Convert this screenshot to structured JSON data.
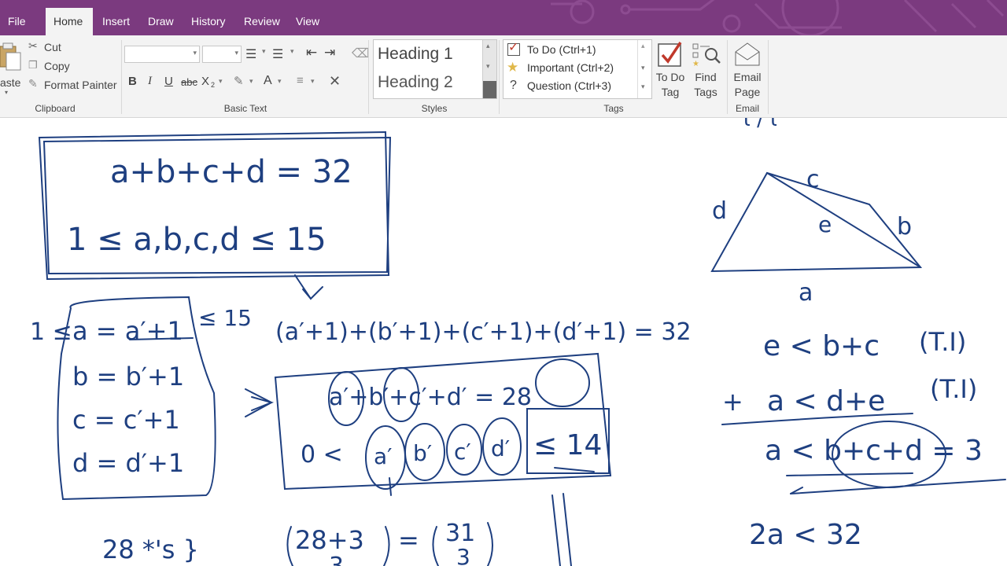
{
  "tabs": [
    "File",
    "Home",
    "Insert",
    "Draw",
    "History",
    "Review",
    "View"
  ],
  "clipboard": {
    "paste_label": "aste",
    "cut": "Cut",
    "copy": "Copy",
    "format_painter": "Format Painter",
    "group_label": "Clipboard"
  },
  "basic_text": {
    "bold": "B",
    "italic": "I",
    "underline": "U",
    "strike": "abc",
    "subscript": "X",
    "font_color": "A",
    "clear": "✕",
    "group_label": "Basic Text"
  },
  "styles": {
    "heading1": "Heading 1",
    "heading2": "Heading 2",
    "group_label": "Styles"
  },
  "tags": {
    "items": [
      "To Do (Ctrl+1)",
      "Important (Ctrl+2)",
      "Question (Ctrl+3)"
    ],
    "todo_tag": [
      "To Do",
      "Tag"
    ],
    "find_tags": [
      "Find",
      "Tags"
    ],
    "group_label": "Tags"
  },
  "email": {
    "label": [
      "Email",
      "Page"
    ],
    "group_label": "Email"
  },
  "ink": {
    "box_eq1": "a+b+c+d = 32",
    "box_eq2": "1 ≤ a,b,c,d ≤ 15",
    "sub_a": "a = a′+1",
    "sub_a_left": "1 ≤",
    "sub_a_right": "≤ 15",
    "sub_b": "b = b′+1",
    "sub_c": "c = c′+1",
    "sub_d": "d = d′+1",
    "expanded": "(a′+1)+(b′+1)+(c′+1)+(d′+1) = 32",
    "reduced": "a′+b′+c′+d′ = 28",
    "bound_zero": "0 <",
    "bound_vars": [
      "a′",
      "b′",
      "c′",
      "d′"
    ],
    "bound_max": "≤ 14",
    "stars": "28 *'s }",
    "binom_top": "28+3",
    "binom_rhs_top": "31",
    "binom_rhs_bot": "3",
    "binom_bot": "3",
    "quad_labels": [
      "c",
      "d",
      "e",
      "b",
      "a"
    ],
    "ineq1": "e < b+c",
    "ineq1_tag": "(T.I)",
    "ineq2_plus": "+",
    "ineq2": "a < d+e",
    "ineq2_tag": "(T.I)",
    "ineq3": "a < b+c+d = 3",
    "ineq4": "2a < 32",
    "fragment_top": "ι / ι"
  }
}
